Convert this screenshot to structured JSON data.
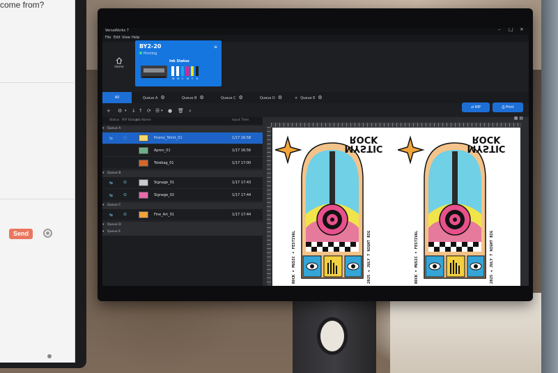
{
  "laptop": {
    "question": "come from?",
    "send_label": "Send"
  },
  "app": {
    "title": "VersaWorks 7",
    "menu": [
      "File",
      "Edit",
      "View",
      "Help"
    ],
    "window_controls": [
      "–",
      "□",
      "×"
    ],
    "home_label": "Home",
    "printer": {
      "name": "BY2-20",
      "status": "Printing",
      "ink_title": "Ink Status",
      "inks": [
        {
          "label": "W",
          "color": "#ffffff"
        },
        {
          "label": "W",
          "color": "#ffffff"
        },
        {
          "label": "C",
          "color": "#1aa7e8"
        },
        {
          "label": "M",
          "color": "#e0248f"
        },
        {
          "label": "Y",
          "color": "#f2e21c"
        },
        {
          "label": "K",
          "color": "#222222"
        }
      ]
    },
    "tabs": [
      {
        "label": "All",
        "active": true
      },
      {
        "label": "Queue A"
      },
      {
        "label": "Queue B"
      },
      {
        "label": "Queue C"
      },
      {
        "label": "Queue D"
      },
      {
        "label": "Queue E"
      }
    ],
    "buttons": {
      "rip": "RIP",
      "print": "Print"
    },
    "columns": [
      "Status",
      "RIP Status",
      "Job Name",
      "Input Time"
    ],
    "groups": [
      {
        "name": "Queue A",
        "jobs": [
          {
            "name": "Promo_Tshirt_01",
            "time": "1/17 16:58",
            "selected": true,
            "thumb": "#f3d76a"
          },
          {
            "name": "Apron_01",
            "time": "1/17 16:56",
            "thumb": "#6fae8a"
          },
          {
            "name": "Totebag_01",
            "time": "1/17 17:00",
            "thumb": "#d2672b"
          }
        ]
      },
      {
        "name": "Queue B",
        "jobs": [
          {
            "name": "Signage_01",
            "time": "1/17 17:43",
            "thumb": "#c9c9c9"
          },
          {
            "name": "Signage_02",
            "time": "1/17 17:44",
            "thumb": "#e86aa8"
          }
        ]
      },
      {
        "name": "Queue C",
        "jobs": [
          {
            "name": "Fine_Art_01",
            "time": "1/17 17:44",
            "thumb": "#f2a33a"
          }
        ]
      },
      {
        "name": "Queue D",
        "jobs": []
      },
      {
        "name": "Queue E",
        "jobs": []
      }
    ],
    "artwork": {
      "title_line1": "MYSTIC",
      "title_line2": "ROCK",
      "side_text": "2025 + JULY 7 NIGHT BIG",
      "side_text2": "ROCK • MUSIC • FESTIVAL"
    }
  }
}
